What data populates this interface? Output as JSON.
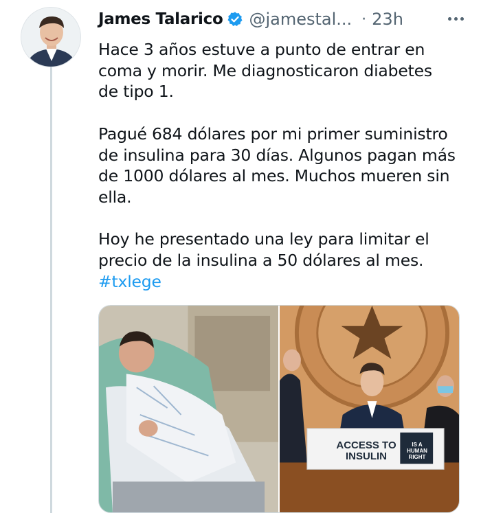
{
  "author": {
    "display_name": "James Talarico",
    "handle": "@jamestal...",
    "separator": "·",
    "timestamp": "23h",
    "verified": true,
    "avatar_icon": "profile-photo"
  },
  "tweet": {
    "paragraphs": [
      [
        "Hace 3 años estuve a punto de entrar en",
        "coma y morir. Me diagnosticaron diabetes",
        "de tipo 1."
      ],
      [
        "Pagué 684 dólares por mi primer suministro",
        "de insulina para 30 días. Algunos pagan más",
        "de 1000 dólares al mes. Muchos mueren sin",
        "ella."
      ],
      [
        "Hoy he presentado una ley para limitar el",
        "precio de la insulina a 50 dólares al mes."
      ]
    ],
    "hashtag": "#txlege"
  },
  "media": {
    "images": [
      {
        "description_icon": "hospital-bed-photo"
      },
      {
        "description_icon": "press-conference-photo",
        "sign": {
          "line1": "ACCESS TO",
          "line2": "INSULIN",
          "badge": [
            "IS A",
            "HUMAN",
            "RIGHT"
          ]
        }
      }
    ]
  },
  "colors": {
    "link": "#1d9bf0",
    "verified": "#1d9bf0",
    "secondary_text": "#536471",
    "thread_line": "#cfd9de"
  }
}
